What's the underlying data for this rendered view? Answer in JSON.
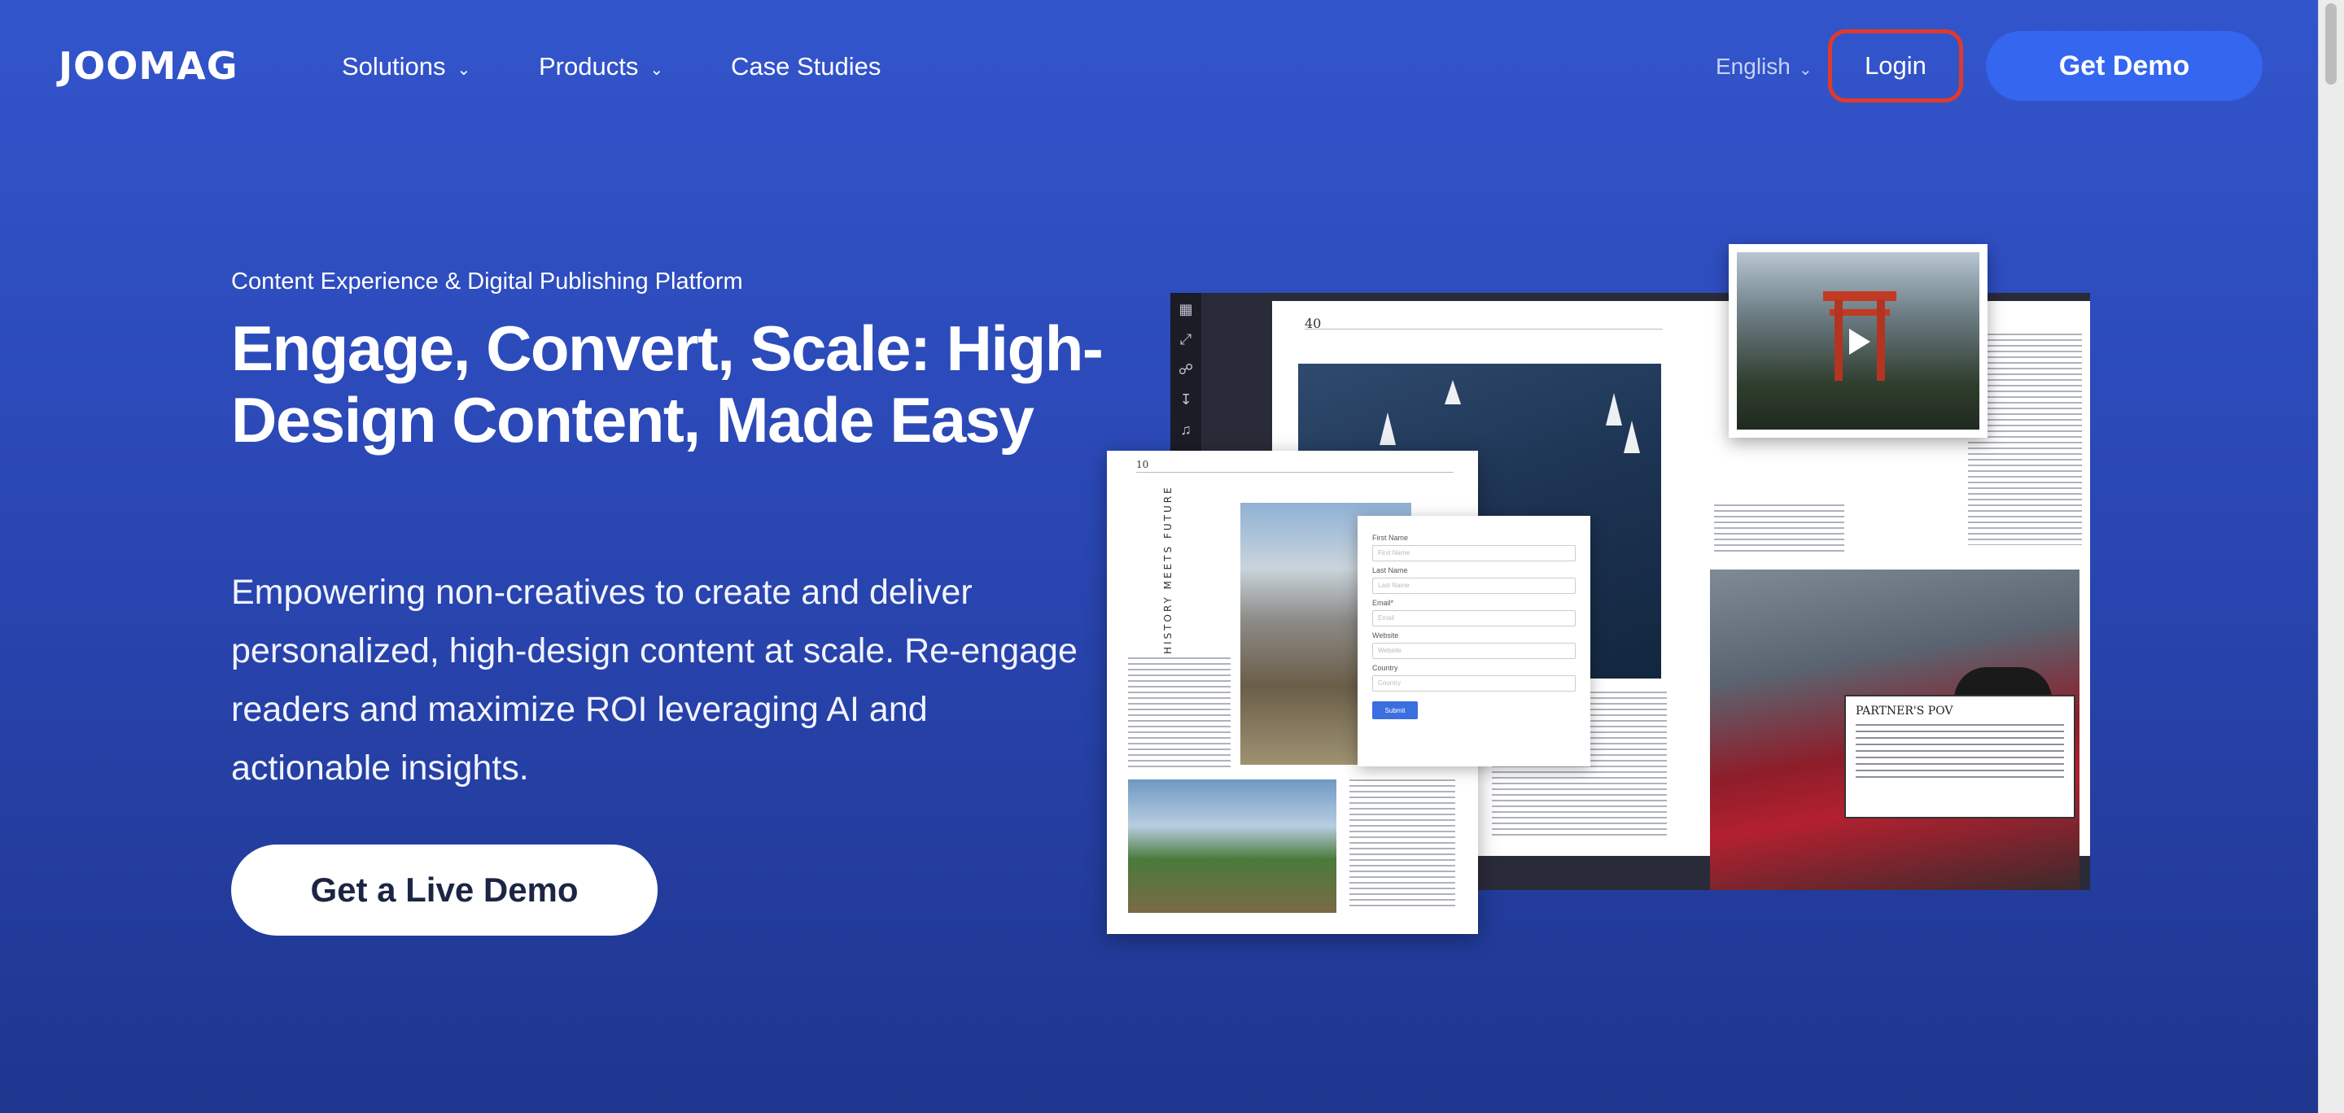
{
  "nav": {
    "logo": "JOOMAG",
    "items": [
      {
        "label": "Solutions",
        "has_dropdown": true
      },
      {
        "label": "Products",
        "has_dropdown": true
      },
      {
        "label": "Case Studies",
        "has_dropdown": false
      }
    ],
    "language": "English",
    "login_label": "Login",
    "get_demo_label": "Get Demo"
  },
  "hero": {
    "eyebrow": "Content Experience & Digital Publishing Platform",
    "headline": "Engage, Convert, Scale: High-Design Content, Made Easy",
    "subtext": "Empowering non-creatives to create and deliver personalized, high-design content at scale. Re-engage readers and maximize ROI leveraging AI and actionable insights.",
    "cta_label": "Get a Live Demo"
  },
  "mockup": {
    "left_page_number": "40",
    "front_page_number": "10",
    "front_page_title": "HISTORY MEETS FUTURE",
    "quote_title": "PARTNER'S POV",
    "form_fields": [
      {
        "label": "First Name",
        "placeholder": "First Name"
      },
      {
        "label": "Last Name",
        "placeholder": "Last Name"
      },
      {
        "label": "Email*",
        "placeholder": "Email"
      },
      {
        "label": "Website",
        "placeholder": "Website"
      },
      {
        "label": "Country",
        "placeholder": "Country"
      }
    ],
    "form_submit": "Submit"
  },
  "colors": {
    "background_top": "#3355cc",
    "background_bottom": "#1f368f",
    "accent_button": "#3466f0",
    "login_highlight": "#e03a2a"
  }
}
